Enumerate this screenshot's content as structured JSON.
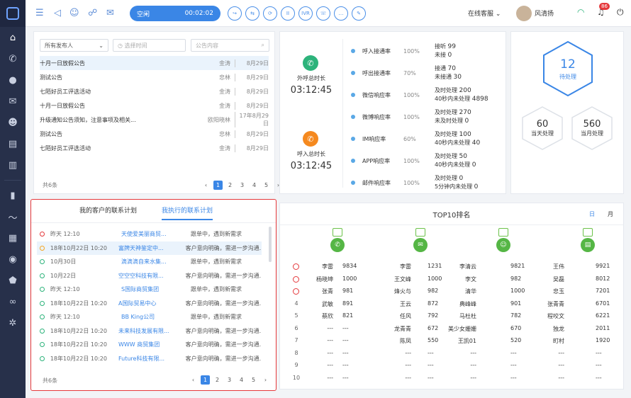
{
  "topbar": {
    "status": "空闲",
    "timer": "00:02:02",
    "call_buttons": [
      "↪",
      "⇆",
      "⟳",
      "II",
      "IVR",
      "☏",
      "…",
      "✎"
    ],
    "service_status": "在线客服",
    "user_name": "风清扬",
    "notification_count": "86"
  },
  "announcements": {
    "filter_publisher": "所有发布人",
    "filter_time_placeholder": "选择时间",
    "filter_content_placeholder": "公告内容",
    "rows": [
      {
        "title": "十月一日放假公告",
        "author": "金涛",
        "date": "8月29日"
      },
      {
        "title": "测试公告",
        "author": "忠林",
        "date": "8月29日"
      },
      {
        "title": "七陌好员工评选活动",
        "author": "金涛",
        "date": "8月29日"
      },
      {
        "title": "十月一日放假公告",
        "author": "金涛",
        "date": "8月29日"
      },
      {
        "title": "升级通知公告须知，注意事项及相关...",
        "author": "欧阳晓林",
        "date": "17年8月29日"
      },
      {
        "title": "测试公告",
        "author": "忠林",
        "date": "8月29日"
      },
      {
        "title": "七陌好员工评选活动",
        "author": "金涛",
        "date": "8月29日"
      }
    ],
    "total": "共6条",
    "pages": [
      "1",
      "2",
      "3",
      "4",
      "5"
    ]
  },
  "calls": {
    "outbound_label": "外呼总时长",
    "outbound_time": "03:12:45",
    "inbound_label": "呼入总时长",
    "inbound_time": "03:12:45"
  },
  "stats": [
    {
      "name": "呼入接通率",
      "pct": "100%",
      "l1": "接听",
      "v1": "99",
      "l2": "未接",
      "v2": "0"
    },
    {
      "name": "呼出接通率",
      "pct": "70%",
      "l1": "接通",
      "v1": "70",
      "l2": "未接通",
      "v2": "30"
    },
    {
      "name": "微信响应率",
      "pct": "100%",
      "l1": "及时处理",
      "v1": "200",
      "l2": "40秒内未处理",
      "v2": "4898"
    },
    {
      "name": "微博响应率",
      "pct": "100%",
      "l1": "及时处理",
      "v1": "270",
      "l2": "未及时处理",
      "v2": "0"
    },
    {
      "name": "IM响应率",
      "pct": "60%",
      "l1": "及时处理",
      "v1": "100",
      "l2": "40秒内未处理",
      "v2": "40"
    },
    {
      "name": "APP响应率",
      "pct": "100%",
      "l1": "及时处理",
      "v1": "50",
      "l2": "40秒内未处理",
      "v2": "0"
    },
    {
      "name": "邮件响应率",
      "pct": "100%",
      "l1": "及时处理",
      "v1": "0",
      "l2": "5分钟内未处理",
      "v2": "0"
    }
  ],
  "pending": {
    "count": "12",
    "label": "待处理",
    "today_count": "60",
    "today_label": "当天处理",
    "month_count": "560",
    "month_label": "当月处理"
  },
  "plans": {
    "tab1": "我的客户的联系计划",
    "tab2": "我执行的联系计划",
    "rows": [
      {
        "time": "昨天 12:10",
        "company": "天使爱美丽商贸...",
        "status": "跟单中，遇到新需求",
        "state": "red"
      },
      {
        "time": "18年10月22日 10:20",
        "company": "富牌天神鉴定中...",
        "status": "客户意向明确，需进一步沟通...",
        "state": "org"
      },
      {
        "time": "10月30日",
        "company": "滴滴滴自来水集...",
        "status": "跟单中，遇到新需求",
        "state": "grn"
      },
      {
        "time": "10月22日",
        "company": "空空空科技有限...",
        "status": "客户意向明确，需进一步沟通...",
        "state": "grn"
      },
      {
        "time": "昨天 12:10",
        "company": "S国际商贸集团",
        "status": "跟单中，遇到新需求",
        "state": "grn"
      },
      {
        "time": "18年10月22日 10:20",
        "company": "A国际贸易中心",
        "status": "客户意向明确，需进一步沟通...",
        "state": "grn"
      },
      {
        "time": "昨天 12:10",
        "company": "BB King公司",
        "status": "跟单中，遇到新需求",
        "state": "grn"
      },
      {
        "time": "18年10月22日 10:20",
        "company": "未来科技发展有限...",
        "status": "客户意向明确，需进一步沟通...",
        "state": "grn"
      },
      {
        "time": "18年10月22日 10:20",
        "company": "WWW 商贸集团",
        "status": "客户意向明确，需进一步沟通...",
        "state": "grn"
      },
      {
        "time": "18年10月22日 10:20",
        "company": "Future科技有限...",
        "status": "客户意向明确，需进一步沟通...",
        "state": "grn"
      }
    ],
    "total": "共6条",
    "pages": [
      "1",
      "2",
      "3",
      "4",
      "5"
    ]
  },
  "top10": {
    "title": "TOP10排名",
    "tab_day": "日",
    "tab_month": "月",
    "ranks": [
      "1",
      "2",
      "3",
      "4",
      "5",
      "6",
      "7",
      "8",
      "9",
      "10"
    ],
    "cols": [
      [
        [
          "李雷",
          "9834"
        ],
        [
          "杨晓坤",
          "1000"
        ],
        [
          "张青",
          "981"
        ],
        [
          "武敏",
          "891"
        ],
        [
          "蔡欣",
          "821"
        ],
        [
          "---",
          "---"
        ],
        [
          "---",
          "---"
        ],
        [
          "---",
          "---"
        ],
        [
          "---",
          "---"
        ],
        [
          "---",
          "---"
        ]
      ],
      [
        [
          "李雷",
          "1231"
        ],
        [
          "王文峰",
          "1000"
        ],
        [
          "烽火与",
          "982"
        ],
        [
          "王云",
          "872"
        ],
        [
          "任风",
          "792"
        ],
        [
          "龙青青",
          "672"
        ],
        [
          "陈凤",
          "550"
        ],
        [
          "---",
          "---"
        ],
        [
          "---",
          "---"
        ],
        [
          "---",
          "---"
        ]
      ],
      [
        [
          "李清云",
          "9821"
        ],
        [
          "李文",
          "982"
        ],
        [
          "清华",
          "1000"
        ],
        [
          "典峰峰",
          "901"
        ],
        [
          "马杜杜",
          "782"
        ],
        [
          "美少女姗姗",
          "670"
        ],
        [
          "王凯01",
          "520"
        ],
        [
          "---",
          "---"
        ],
        [
          "---",
          "---"
        ],
        [
          "---",
          "---"
        ]
      ],
      [
        [
          "王伟",
          "9921"
        ],
        [
          "吴磊",
          "8012"
        ],
        [
          "忠玉",
          "7201"
        ],
        [
          "张青青",
          "6701"
        ],
        [
          "程咬文",
          "6221"
        ],
        [
          "独龙",
          "2011"
        ],
        [
          "町村",
          "1920"
        ],
        [
          "---",
          "---"
        ],
        [
          "---",
          "---"
        ],
        [
          "---",
          "---"
        ]
      ]
    ]
  }
}
